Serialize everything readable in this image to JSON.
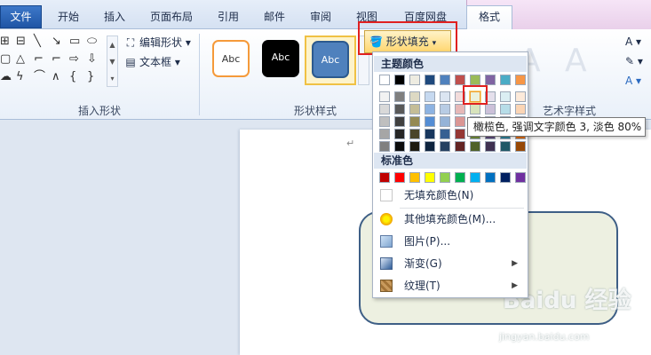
{
  "tabs": [
    {
      "label": "文件"
    },
    {
      "label": "开始"
    },
    {
      "label": "插入"
    },
    {
      "label": "页面布局"
    },
    {
      "label": "引用"
    },
    {
      "label": "邮件"
    },
    {
      "label": "审阅"
    },
    {
      "label": "视图"
    },
    {
      "label": "百度网盘"
    },
    {
      "label": "格式"
    }
  ],
  "ribbon": {
    "insert_shapes": {
      "label": "插入形状",
      "edit_shape": "编辑形状",
      "text_box": "文本框"
    },
    "shape_styles": {
      "label": "形状样式",
      "style_text": "Abc",
      "fill_button": "形状填充"
    },
    "wordart": {
      "label": "艺术字样式",
      "letter": "A"
    }
  },
  "fill_menu": {
    "theme_colors_header": "主题颜色",
    "standard_colors_header": "标准色",
    "no_fill": "无填充颜色(N)",
    "more_colors": "其他填充颜色(M)...",
    "picture": "图片(P)...",
    "gradient": "渐变(G)",
    "texture": "纹理(T)",
    "theme_colors": [
      [
        "#ffffff",
        "#f2f2f2",
        "#d9d9d9",
        "#bfbfbf",
        "#a6a6a6",
        "#808080"
      ],
      [
        "#000000",
        "#7f7f7f",
        "#595959",
        "#404040",
        "#262626",
        "#0d0d0d"
      ],
      [
        "#eeece1",
        "#ddd9c3",
        "#c4bd97",
        "#948a54",
        "#4a452a",
        "#1d1b10"
      ],
      [
        "#1f497d",
        "#c6d9f0",
        "#8db3e2",
        "#548dd4",
        "#17365d",
        "#0f243e"
      ],
      [
        "#4f81bd",
        "#dbe5f1",
        "#b8cce4",
        "#95b3d7",
        "#366092",
        "#244061"
      ],
      [
        "#c0504d",
        "#f2dcdb",
        "#e6b8b7",
        "#da9694",
        "#953734",
        "#632423"
      ],
      [
        "#9bbb59",
        "#ebf1dd",
        "#d7e3bc",
        "#c3d69b",
        "#76923c",
        "#4f6128"
      ],
      [
        "#8064a2",
        "#e5e0ec",
        "#ccc1d9",
        "#b2a2c7",
        "#5f497a",
        "#3f3151"
      ],
      [
        "#4bacc6",
        "#dbeef3",
        "#b7dde8",
        "#92cddc",
        "#31859b",
        "#205867"
      ],
      [
        "#f79646",
        "#fdeada",
        "#fbd5b5",
        "#fac08f",
        "#e36c09",
        "#974806"
      ]
    ],
    "standard_colors": [
      "#c00000",
      "#ff0000",
      "#ffc000",
      "#ffff00",
      "#92d050",
      "#00b050",
      "#00b0f0",
      "#0070c0",
      "#002060",
      "#7030a0"
    ]
  },
  "tooltip": "橄榄色, 强调文字颜色 3, 淡色 80%",
  "watermark": {
    "main": "Baidu 经验",
    "sub": "jingyan.baidu.com"
  }
}
